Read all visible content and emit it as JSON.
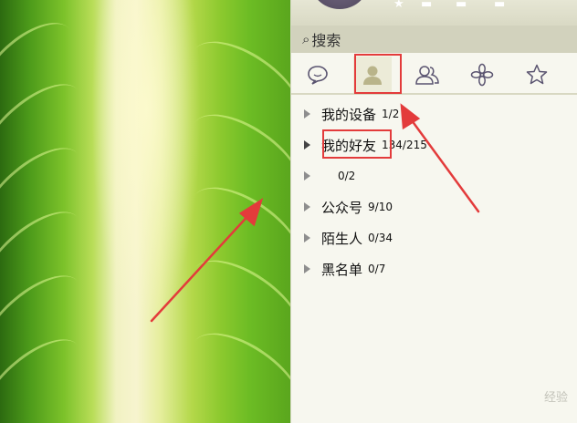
{
  "search": {
    "placeholder": "搜索"
  },
  "tabs": [
    {
      "name": "messages",
      "icon": "chat-bubble-icon"
    },
    {
      "name": "contacts",
      "icon": "person-icon",
      "active": true
    },
    {
      "name": "groups",
      "icon": "people-icon"
    },
    {
      "name": "apps",
      "icon": "flower-icon"
    },
    {
      "name": "favorites",
      "icon": "star-icon"
    }
  ],
  "groups": [
    {
      "name": "我的设备",
      "count": "1/2"
    },
    {
      "name": "我的好友",
      "count": "134/215"
    },
    {
      "name": "",
      "count": "0/2"
    },
    {
      "name": "公众号",
      "count": "9/10"
    },
    {
      "name": "陌生人",
      "count": "0/34"
    },
    {
      "name": "黑名单",
      "count": "0/7"
    }
  ],
  "colors": {
    "annotation": "#e33b3b",
    "panel_bg": "#f7f7ef",
    "search_bg": "#d2d2bd"
  },
  "watermark": "经验"
}
